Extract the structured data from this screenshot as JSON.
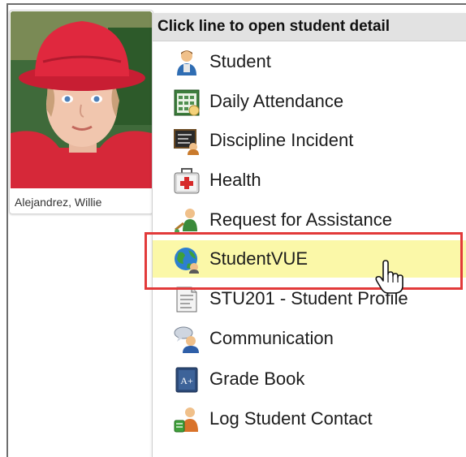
{
  "student": {
    "name": "Alejandrez, Willie"
  },
  "menu": {
    "header": "Click line to open student detail",
    "items": [
      {
        "label": "Student",
        "icon": "student-icon"
      },
      {
        "label": "Daily Attendance",
        "icon": "attendance-calendar-icon"
      },
      {
        "label": "Discipline Incident",
        "icon": "discipline-chalkboard-icon"
      },
      {
        "label": "Health",
        "icon": "health-kit-icon"
      },
      {
        "label": "Request for Assistance",
        "icon": "request-assistance-icon"
      },
      {
        "label": "StudentVUE",
        "icon": "globe-icon",
        "highlighted": true
      },
      {
        "label": "STU201 - Student Profile",
        "icon": "report-document-icon"
      },
      {
        "label": "Communication",
        "icon": "communication-icon"
      },
      {
        "label": "Grade Book",
        "icon": "grade-book-icon"
      },
      {
        "label": "Log Student Contact",
        "icon": "log-contact-icon"
      }
    ]
  },
  "colors": {
    "highlight_fill": "#fbf8a8",
    "callout_border": "#e23a3a",
    "header_bg": "#e2e2e2"
  }
}
